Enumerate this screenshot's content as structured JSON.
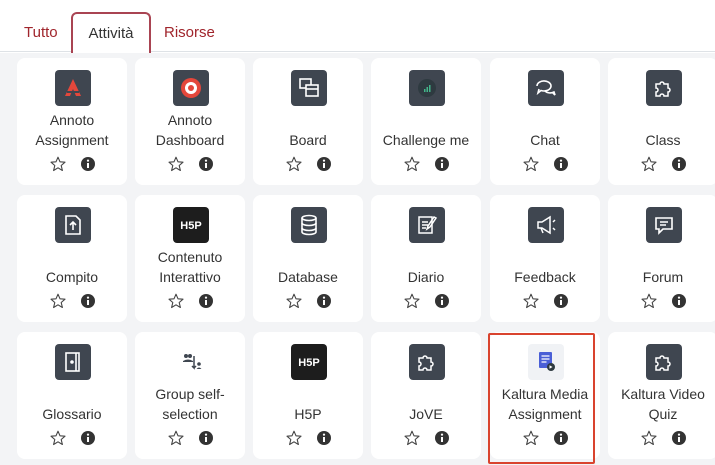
{
  "tabs": [
    {
      "label": "Tutto"
    },
    {
      "label": "Attività"
    },
    {
      "label": "Risorse"
    }
  ],
  "cards": [
    {
      "line1": "Annoto",
      "line2": "Assignment",
      "icon": "annoto-icon"
    },
    {
      "line1": "Annoto",
      "line2": "Dashboard",
      "icon": "annoto-dashboard-icon"
    },
    {
      "line1": "",
      "line2": "Board",
      "icon": "board-icon"
    },
    {
      "line1": "",
      "line2": "Challenge me",
      "icon": "challenge-icon"
    },
    {
      "line1": "",
      "line2": "Chat",
      "icon": "chat-icon"
    },
    {
      "line1": "",
      "line2": "Class",
      "icon": "puzzle-icon"
    },
    {
      "line1": "",
      "line2": "Compito",
      "icon": "assignment-upload-icon"
    },
    {
      "line1": "Contenuto",
      "line2": "Interattivo",
      "icon": "h5p-icon"
    },
    {
      "line1": "",
      "line2": "Database",
      "icon": "database-icon"
    },
    {
      "line1": "",
      "line2": "Diario",
      "icon": "journal-icon"
    },
    {
      "line1": "",
      "line2": "Feedback",
      "icon": "megaphone-icon"
    },
    {
      "line1": "",
      "line2": "Forum",
      "icon": "forum-icon"
    },
    {
      "line1": "",
      "line2": "Glossario",
      "icon": "glossary-icon"
    },
    {
      "line1": "Group self-",
      "line2": "selection",
      "icon": "group-selection-icon"
    },
    {
      "line1": "",
      "line2": "H5P",
      "icon": "h5p-icon"
    },
    {
      "line1": "",
      "line2": "JoVE",
      "icon": "puzzle-icon"
    },
    {
      "line1": "Kaltura Media",
      "line2": "Assignment",
      "icon": "kaltura-assignment-icon"
    },
    {
      "line1": "Kaltura Video",
      "line2": "Quiz",
      "icon": "puzzle-icon"
    }
  ],
  "colors": {
    "tab_text": "#a0252c",
    "active_tab_border": "#a94452",
    "highlight": "#d9432e",
    "icon_bg": "#3f4650"
  }
}
